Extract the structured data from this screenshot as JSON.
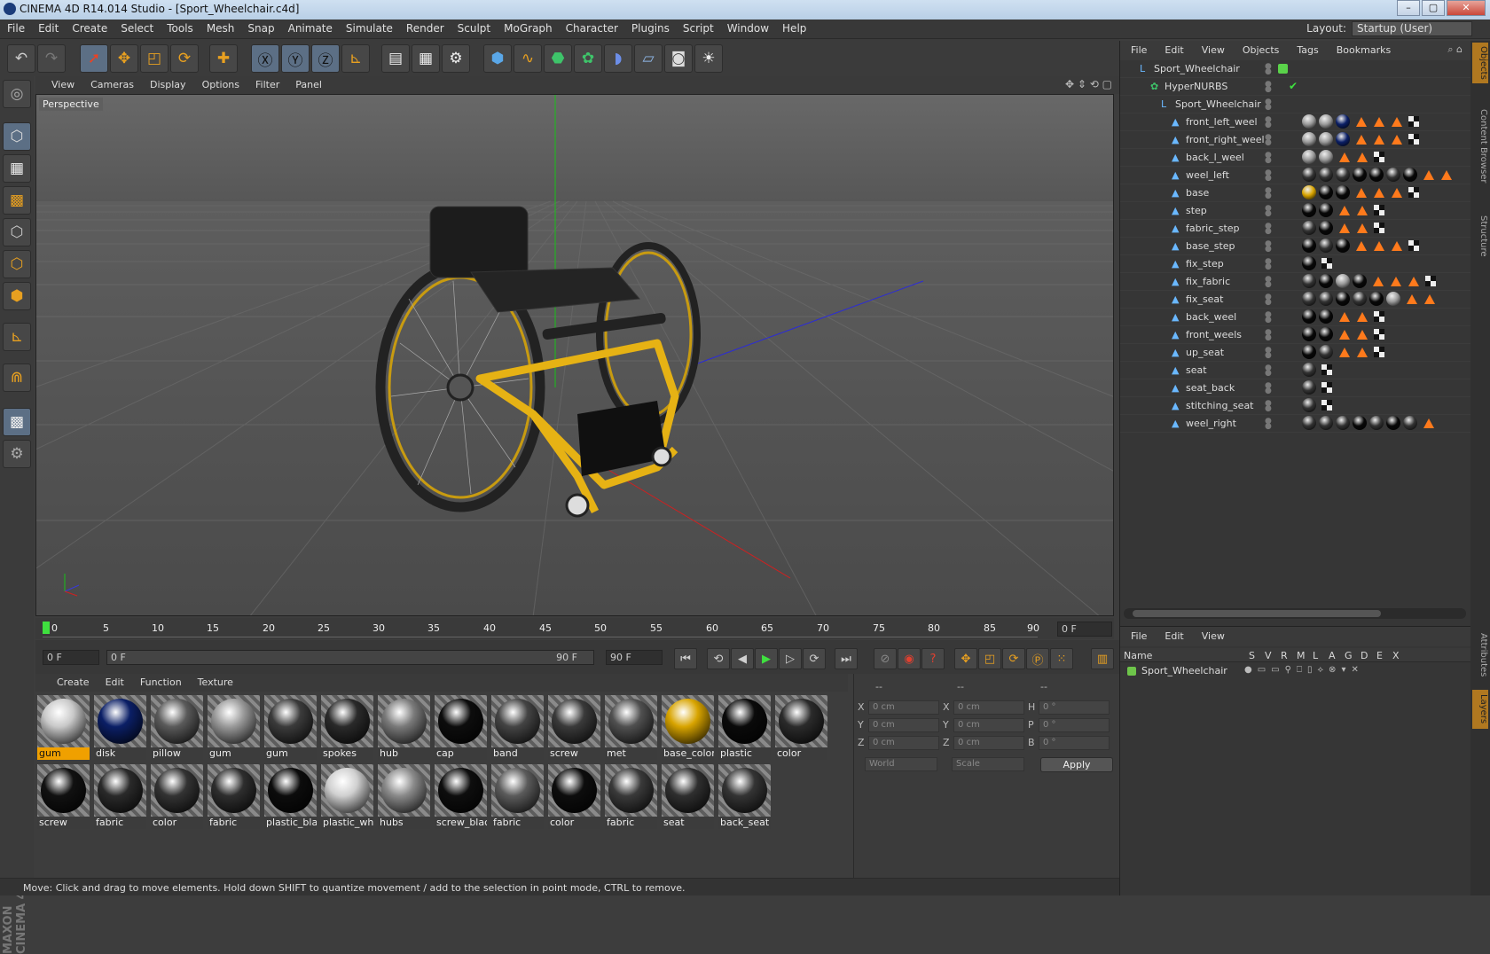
{
  "window": {
    "title": "CINEMA 4D R14.014 Studio - [Sport_Wheelchair.c4d]",
    "buttons": [
      "–",
      "▢",
      "✕"
    ]
  },
  "menubar": {
    "items": [
      "File",
      "Edit",
      "Create",
      "Select",
      "Tools",
      "Mesh",
      "Snap",
      "Animate",
      "Simulate",
      "Render",
      "Sculpt",
      "MoGraph",
      "Character",
      "Plugins",
      "Script",
      "Window",
      "Help"
    ],
    "layout_label": "Layout:",
    "layout_value": "Startup (User)"
  },
  "toolbar_icons": [
    "undo-icon",
    "redo-icon",
    "live-selection-icon",
    "move-icon",
    "scale-icon",
    "rotate-icon",
    "last-tool-icon",
    "x-axis-icon",
    "y-axis-icon",
    "z-axis-icon",
    "coordinate-system-icon",
    "render-view-icon",
    "render-picture-viewer-icon",
    "edit-render-settings-icon",
    "cube-icon",
    "spline-icon",
    "nurbs-icon",
    "array-icon",
    "deformer-icon",
    "floor-icon",
    "camera-icon",
    "light-icon"
  ],
  "viewport": {
    "menu": [
      "View",
      "Cameras",
      "Display",
      "Options",
      "Filter",
      "Panel"
    ],
    "label": "Perspective"
  },
  "timeline": {
    "ticks": [
      "0",
      "5",
      "10",
      "15",
      "20",
      "25",
      "30",
      "35",
      "40",
      "45",
      "50",
      "55",
      "60",
      "65",
      "70",
      "75",
      "80",
      "85",
      "90"
    ],
    "current_frame": "0 F"
  },
  "transport": {
    "start": "0 F",
    "range_start": "0 F",
    "range_end": "90 F",
    "end": "90 F"
  },
  "materials": {
    "menu": [
      "Create",
      "Edit",
      "Function",
      "Texture"
    ],
    "row1": [
      {
        "name": "gum",
        "color": "#c9c9c9",
        "selected": true
      },
      {
        "name": "disk",
        "color": "#0b1f66",
        "selected": false
      },
      {
        "name": "pillow",
        "color": "#5a5a5a",
        "selected": false
      },
      {
        "name": "gum",
        "color": "#9a9a9a",
        "selected": false
      },
      {
        "name": "gum",
        "color": "#3b3b3b",
        "selected": false
      },
      {
        "name": "spokes",
        "color": "#2a2a2a",
        "selected": false
      },
      {
        "name": "hub",
        "color": "#7a7a7a",
        "selected": false
      },
      {
        "name": "cap",
        "color": "#0d0d0d",
        "selected": false
      },
      {
        "name": "band",
        "color": "#444444",
        "selected": false
      },
      {
        "name": "screw",
        "color": "#3a3a3a",
        "selected": false
      },
      {
        "name": "met",
        "color": "#505050",
        "selected": false
      },
      {
        "name": "base_color",
        "color": "#d8a400",
        "selected": false
      },
      {
        "name": "plastic",
        "color": "#0a0a0a",
        "selected": false
      },
      {
        "name": "color",
        "color": "#2b2b2b",
        "selected": false
      }
    ],
    "row2": [
      {
        "name": "screw",
        "color": "#111111",
        "selected": false
      },
      {
        "name": "fabric",
        "color": "#2a2a2a",
        "selected": false
      },
      {
        "name": "color",
        "color": "#333333",
        "selected": false
      },
      {
        "name": "fabric",
        "color": "#2e2e2e",
        "selected": false
      },
      {
        "name": "plastic_bla",
        "color": "#0c0c0c",
        "selected": false
      },
      {
        "name": "plastic_whi",
        "color": "#d0d0d0",
        "selected": false
      },
      {
        "name": "hubs",
        "color": "#8a8a8a",
        "selected": false
      },
      {
        "name": "screw_blac",
        "color": "#0e0e0e",
        "selected": false
      },
      {
        "name": "fabric",
        "color": "#5b5b5b",
        "selected": false
      },
      {
        "name": "color",
        "color": "#0d0d0d",
        "selected": false
      },
      {
        "name": "fabric",
        "color": "#3a3a3a",
        "selected": false
      },
      {
        "name": "seat",
        "color": "#2f2f2f",
        "selected": false
      },
      {
        "name": "back_seat",
        "color": "#343434",
        "selected": false
      }
    ]
  },
  "coordinates": {
    "headers": [
      "--",
      "--",
      "--"
    ],
    "rows": [
      {
        "a": "X",
        "av": "0 cm",
        "b": "X",
        "bv": "0 cm",
        "c": "H",
        "cv": "0 °"
      },
      {
        "a": "Y",
        "av": "0 cm",
        "b": "Y",
        "bv": "0 cm",
        "c": "P",
        "cv": "0 °"
      },
      {
        "a": "Z",
        "av": "0 cm",
        "b": "Z",
        "bv": "0 cm",
        "c": "B",
        "cv": "0 °"
      }
    ],
    "mode1": "World",
    "mode2": "Scale",
    "apply": "Apply"
  },
  "objects": {
    "menu": [
      "File",
      "Edit",
      "View",
      "Objects",
      "Tags",
      "Bookmarks"
    ],
    "rows": [
      {
        "name": "Sport_Wheelchair",
        "indent": 0,
        "icon": "null-icon",
        "tags": []
      },
      {
        "name": "HyperNURBS",
        "indent": 1,
        "icon": "hypernurbs-icon",
        "tags": []
      },
      {
        "name": "Sport_Wheelchair",
        "indent": 2,
        "icon": "null-icon",
        "tags": []
      },
      {
        "name": "front_left_weel",
        "indent": 3,
        "icon": "polygon-icon",
        "tags": [
          "m",
          "m",
          "b",
          "t",
          "t",
          "t",
          "c"
        ]
      },
      {
        "name": "front_right_weel",
        "indent": 3,
        "icon": "polygon-icon",
        "tags": [
          "m",
          "m",
          "b",
          "t",
          "t",
          "t",
          "c"
        ]
      },
      {
        "name": "back_l_weel",
        "indent": 3,
        "icon": "polygon-icon",
        "tags": [
          "m",
          "m",
          "t",
          "t",
          "c"
        ]
      },
      {
        "name": "weel_left",
        "indent": 3,
        "icon": "polygon-icon",
        "tags": [
          "d",
          "d",
          "d",
          "k",
          "k",
          "d",
          "k",
          "t",
          "t"
        ]
      },
      {
        "name": "base",
        "indent": 3,
        "icon": "polygon-icon",
        "tags": [
          "y",
          "k",
          "k",
          "t",
          "t",
          "t",
          "c"
        ]
      },
      {
        "name": "step",
        "indent": 3,
        "icon": "polygon-icon",
        "tags": [
          "k",
          "k",
          "t",
          "t",
          "c"
        ]
      },
      {
        "name": "fabric_step",
        "indent": 3,
        "icon": "polygon-icon",
        "tags": [
          "d",
          "k",
          "t",
          "t",
          "c"
        ]
      },
      {
        "name": "base_step",
        "indent": 3,
        "icon": "polygon-icon",
        "tags": [
          "k",
          "d",
          "k",
          "t",
          "t",
          "t",
          "c"
        ]
      },
      {
        "name": "fix_step",
        "indent": 3,
        "icon": "polygon-icon",
        "tags": [
          "k",
          "c"
        ]
      },
      {
        "name": "fix_fabric",
        "indent": 3,
        "icon": "polygon-icon",
        "tags": [
          "d",
          "k",
          "m",
          "k",
          "t",
          "t",
          "t",
          "c"
        ]
      },
      {
        "name": "fix_seat",
        "indent": 3,
        "icon": "polygon-icon",
        "tags": [
          "d",
          "d",
          "k",
          "d",
          "k",
          "m",
          "t",
          "t"
        ]
      },
      {
        "name": "back_weel",
        "indent": 3,
        "icon": "polygon-icon",
        "tags": [
          "k",
          "k",
          "t",
          "t",
          "c"
        ]
      },
      {
        "name": "front_weels",
        "indent": 3,
        "icon": "polygon-icon",
        "tags": [
          "k",
          "k",
          "t",
          "t",
          "c"
        ]
      },
      {
        "name": "up_seat",
        "indent": 3,
        "icon": "polygon-icon",
        "tags": [
          "k",
          "d",
          "t",
          "t",
          "c"
        ]
      },
      {
        "name": "seat",
        "indent": 3,
        "icon": "polygon-icon",
        "tags": [
          "d",
          "c"
        ]
      },
      {
        "name": "seat_back",
        "indent": 3,
        "icon": "polygon-icon",
        "tags": [
          "d",
          "c"
        ]
      },
      {
        "name": "stitching_seat",
        "indent": 3,
        "icon": "polygon-icon",
        "tags": [
          "d",
          "c"
        ]
      },
      {
        "name": "weel_right",
        "indent": 3,
        "icon": "polygon-icon",
        "tags": [
          "d",
          "d",
          "d",
          "k",
          "d",
          "k",
          "d",
          "t"
        ]
      }
    ]
  },
  "layers": {
    "menu": [
      "File",
      "Edit",
      "View"
    ],
    "columns": [
      "Name",
      "S",
      "V",
      "R",
      "M",
      "L",
      "A",
      "G",
      "D",
      "E",
      "X"
    ],
    "row": "Sport_Wheelchair"
  },
  "right_tabs": [
    "Objects",
    "Content Browser",
    "Structure",
    "Attributes",
    "Layers"
  ],
  "status": "Move: Click and drag to move elements. Hold down SHIFT to quantize movement / add to the selection in point mode, CTRL to remove.",
  "brand": "MAXON CINEMA 4D"
}
